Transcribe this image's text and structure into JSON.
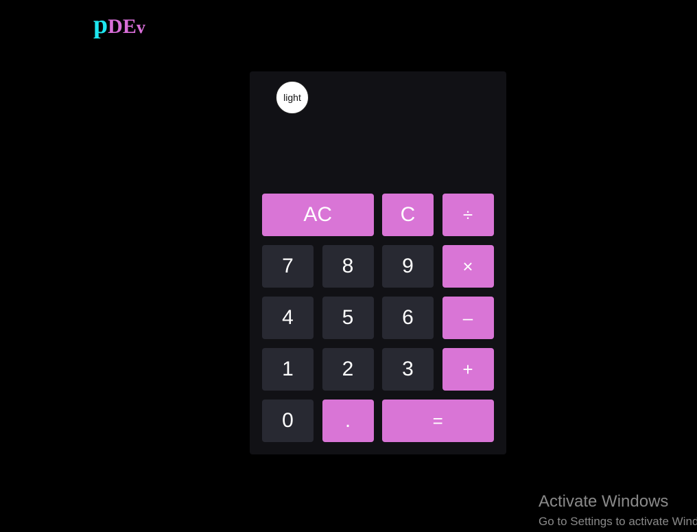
{
  "logo": {
    "p": "p",
    "d": "D",
    "e": "E",
    "v": "v"
  },
  "calculator": {
    "theme_toggle_label": "light",
    "display_value": "",
    "keys": {
      "ac": "AC",
      "c": "C",
      "divide": "÷",
      "seven": "7",
      "eight": "8",
      "nine": "9",
      "multiply": "×",
      "four": "4",
      "five": "5",
      "six": "6",
      "minus": "–",
      "one": "1",
      "two": "2",
      "three": "3",
      "plus": "+",
      "zero": "0",
      "decimal": ".",
      "equals": "="
    },
    "colors": {
      "accent": "#d975d6",
      "number_key": "#282932",
      "panel": "#111115",
      "logo_p": "#1ee6f0",
      "logo_rest": "#d86ed8"
    }
  },
  "watermark": {
    "title": "Activate Windows",
    "subtitle": "Go to Settings to activate Windows."
  }
}
